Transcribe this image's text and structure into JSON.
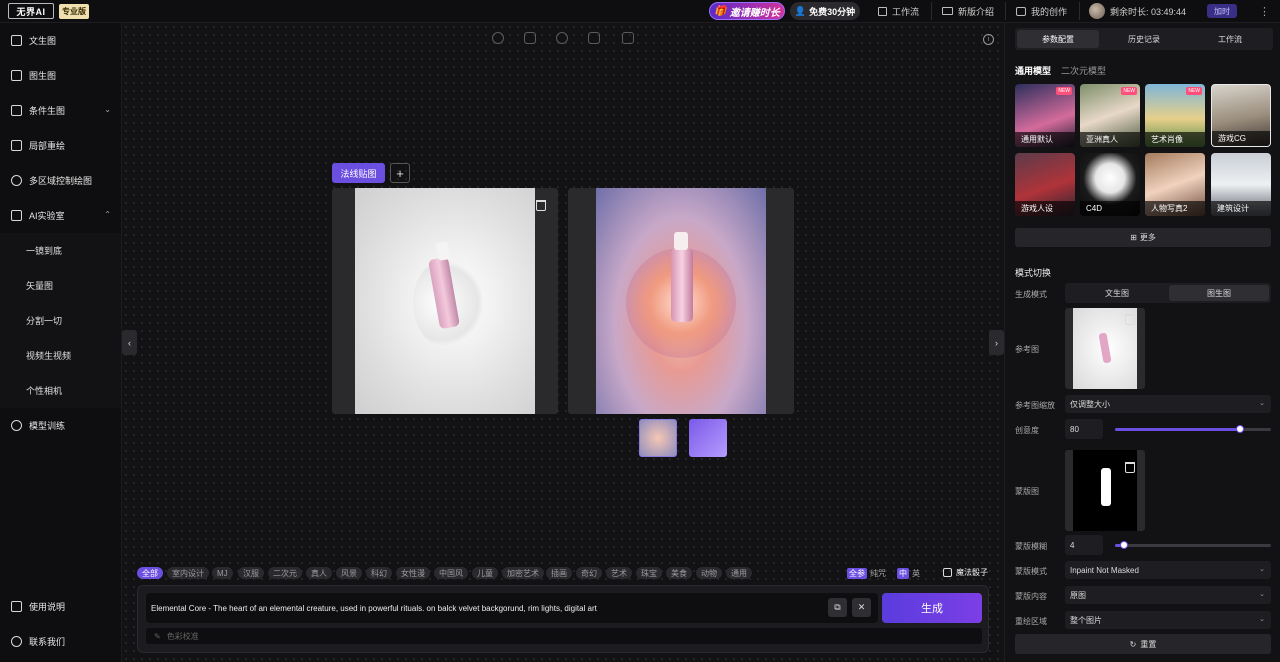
{
  "header": {
    "logo_text": "无界AI",
    "pro_badge": "专业版",
    "invite_label": "邀请赚时长",
    "free_label": "免费30分钟",
    "workflow_label": "工作流",
    "new_intro_label": "新版介绍",
    "my_creations_label": "我的创作",
    "remaining_label": "剩余时长: 03:49:44",
    "recharge_label": "加时"
  },
  "sidebar": {
    "items": [
      {
        "label": "文生图",
        "icon": "image-text-icon"
      },
      {
        "label": "图生图",
        "icon": "image-image-icon"
      },
      {
        "label": "条件生图",
        "icon": "condition-icon"
      },
      {
        "label": "局部重绘",
        "icon": "repaint-icon"
      },
      {
        "label": "多区域控制绘图",
        "icon": "region-icon"
      },
      {
        "label": "AI实验室",
        "icon": "lab-icon"
      }
    ],
    "lab_sub": [
      "一镜到底",
      "矢量图",
      "分割一切",
      "视频生视频",
      "个性相机"
    ],
    "training": "模型训练",
    "help": "使用说明",
    "contact": "联系我们"
  },
  "canvas": {
    "normal_map_button": "法线贴图",
    "add_button": "+"
  },
  "tags": [
    "全部",
    "室内设计",
    "MJ",
    "汉服",
    "二次元",
    "真人",
    "风景",
    "科幻",
    "女性漫",
    "中国风",
    "儿童",
    "加密艺术",
    "插画",
    "奇幻",
    "艺术",
    "珠宝",
    "美食",
    "动物",
    "通用"
  ],
  "prompt": {
    "text": "Elemental Core - The heart of an elemental creature, used in powerful rituals. on balck velvet backgorund, rim lights, digital art",
    "negative_placeholder": "色彩校准",
    "generate_label": "生成",
    "tool_allparams_badge": "全参",
    "tool_allparams_label": "纯咒",
    "tool_lang_badge": "中",
    "tool_lang_label": "英",
    "magic_dice_label": "魔法骰子"
  },
  "panel": {
    "tabs": [
      "参数配置",
      "历史记录",
      "工作流"
    ],
    "model_tabs": [
      "通用模型",
      "二次元模型"
    ],
    "models": [
      {
        "label": "通用默认",
        "new": "NEW"
      },
      {
        "label": "亚洲真人",
        "new": "NEW"
      },
      {
        "label": "艺术肖像",
        "new": "NEW"
      },
      {
        "label": "游戏CG",
        "new": ""
      },
      {
        "label": "游戏人设",
        "new": ""
      },
      {
        "label": "C4D",
        "new": ""
      },
      {
        "label": "人物写真2",
        "new": ""
      },
      {
        "label": "建筑设计",
        "new": ""
      }
    ],
    "more_label": "更多",
    "mode_title": "模式切换",
    "gen_mode_label": "生成模式",
    "gen_modes": [
      "文生图",
      "图生图"
    ],
    "ref_label": "参考图",
    "ref_scale_label": "参考图缩放",
    "ref_scale_value": "仅调整大小",
    "creativity_label": "创意度",
    "creativity_value": "80",
    "mask_label": "蒙版图",
    "mask_blur_label": "蒙版模糊",
    "mask_blur_value": "4",
    "mask_mode_label": "蒙版模式",
    "mask_mode_value": "Inpaint Not Masked",
    "mask_content_label": "蒙版内容",
    "mask_content_value": "原图",
    "redraw_area_label": "重绘区域",
    "redraw_area_value": "整个图片",
    "reset_label": "重置",
    "creativity_fraction": 0.8,
    "mask_blur_fraction": 0.06
  },
  "colors": {
    "accent": "#6a4fe0",
    "new_badge": "#ff4f7a"
  }
}
